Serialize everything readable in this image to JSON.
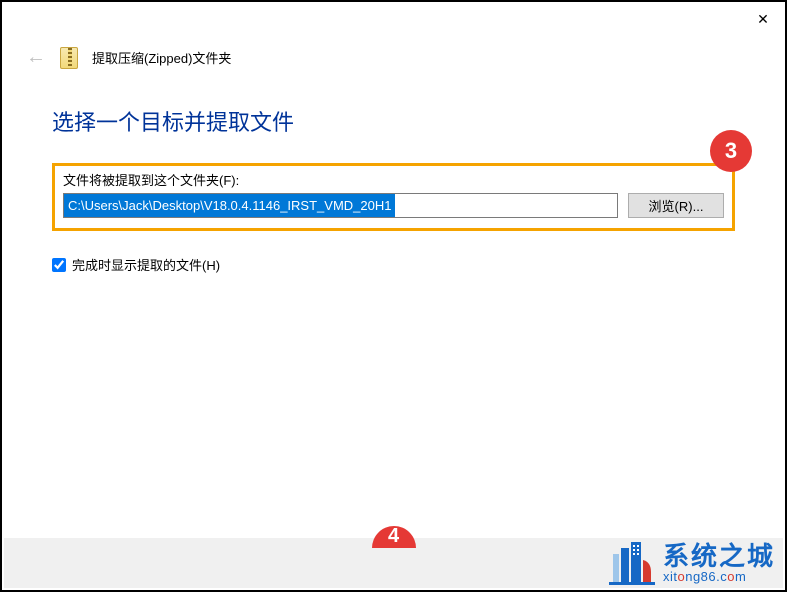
{
  "titlebar": {
    "close_glyph": "✕"
  },
  "header": {
    "back_glyph": "←",
    "title": "提取压缩(Zipped)文件夹"
  },
  "main": {
    "instruction": "选择一个目标并提取文件",
    "field_label": "文件将被提取到这个文件夹(F):",
    "path_value": "C:\\Users\\Jack\\Desktop\\V18.0.4.1146_IRST_VMD_20H1",
    "browse_label": "浏览(R)...",
    "checkbox_label": "完成时显示提取的文件(H)",
    "checkbox_checked": true
  },
  "annotations": {
    "step_badge": "3",
    "partial_badge": "4"
  },
  "watermark": {
    "text_cn": "系统之城",
    "text_en_prefix": "xit",
    "text_en_o": "o",
    "text_en_suffix": "ng86.c",
    "text_en_o2": "o",
    "text_en_end": "m"
  },
  "colors": {
    "highlight_border": "#f5a300",
    "badge_red": "#e53935",
    "link_blue": "#003399",
    "brand_blue": "#1668c5",
    "selection_blue": "#0078d7"
  }
}
